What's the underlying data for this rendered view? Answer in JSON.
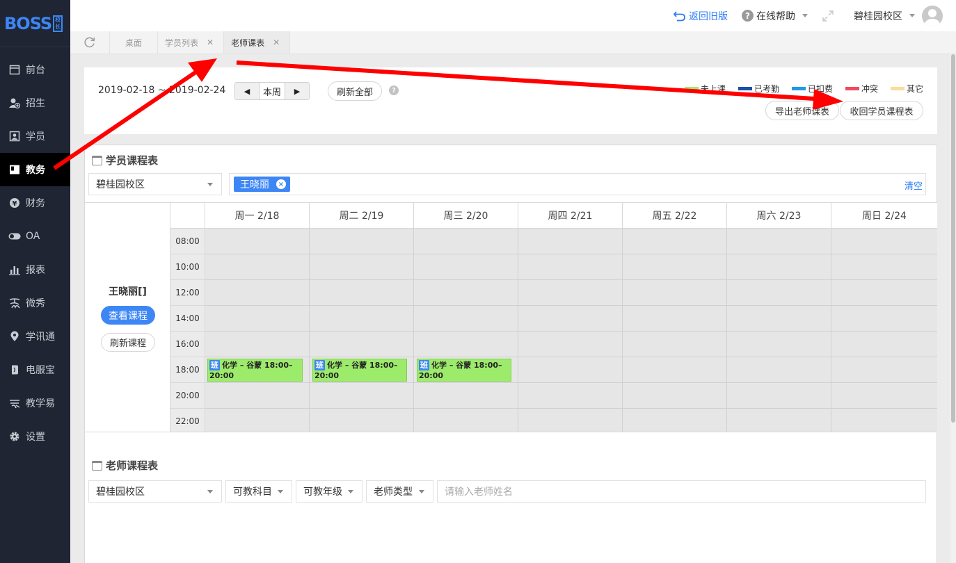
{
  "logo": {
    "text": "BOSS",
    "badge_top": "校",
    "badge_bottom": "长"
  },
  "sidebar": {
    "items": [
      {
        "label": "前台",
        "icon": "calendar-icon"
      },
      {
        "label": "招生",
        "icon": "user-add-icon"
      },
      {
        "label": "学员",
        "icon": "id-card-icon"
      },
      {
        "label": "教务",
        "icon": "book-icon",
        "active": true
      },
      {
        "label": "财务",
        "icon": "yen-icon"
      },
      {
        "label": "OA",
        "icon": "toggle-icon"
      },
      {
        "label": "报表",
        "icon": "bar-chart-icon"
      },
      {
        "label": "微秀",
        "icon": "xiu-icon"
      },
      {
        "label": "学讯通",
        "icon": "location-pin-icon"
      },
      {
        "label": "电服宝",
        "icon": "phone-icon"
      },
      {
        "label": "教学易",
        "icon": "teach-icon"
      },
      {
        "label": "设置",
        "icon": "gear-icon"
      }
    ]
  },
  "header": {
    "back_label": "返回旧版",
    "help_label": "在线帮助",
    "campus_label": "碧桂园校区"
  },
  "tabs": [
    {
      "label": "桌面",
      "closable": false
    },
    {
      "label": "学员列表",
      "closable": true
    },
    {
      "label": "老师课表",
      "closable": true,
      "active": true
    }
  ],
  "toolbar": {
    "date_range": "2019-02-18 ~ 2019-02-24",
    "prev": "◀",
    "this_week": "本周",
    "next": "▶",
    "refresh_all": "刷新全部",
    "help": "?",
    "export_teacher": "导出老师课表",
    "collapse_student": "收回学员课程表",
    "legend": [
      {
        "label": "未上课",
        "color": "#9deb6b"
      },
      {
        "label": "已考勤",
        "color": "#1b4fa8"
      },
      {
        "label": "已扣费",
        "color": "#1e9be8"
      },
      {
        "label": "冲突",
        "color": "#f04a5d"
      },
      {
        "label": "其它",
        "color": "#fbdc9c"
      }
    ]
  },
  "student_schedule": {
    "title": "学员课程表",
    "campus": "碧桂园校区",
    "tag": "王晓丽",
    "tag_remove": "×",
    "clear": "清空",
    "student_name": "王晓丽[]",
    "view_course": "查看课程",
    "refresh_course": "刷新课程",
    "days": [
      "周一 2/18",
      "周二 2/19",
      "周三 2/20",
      "周四 2/21",
      "周五 2/22",
      "周六 2/23",
      "周日 2/24"
    ],
    "times": [
      "08:00",
      "10:00",
      "12:00",
      "14:00",
      "16:00",
      "18:00",
      "20:00",
      "22:00"
    ],
    "events": [
      {
        "badge": "班",
        "text": "化学 – 谷蒙 18:00–20:00"
      },
      {
        "badge": "班",
        "text": "化学 – 谷蒙 18:00–20:00"
      },
      {
        "badge": "班",
        "text": "化学 – 谷蒙 18:00–20:00"
      }
    ]
  },
  "teacher_schedule": {
    "title": "老师课程表",
    "campus": "碧桂园校区",
    "subject": "可教科目",
    "grade": "可教年级",
    "teacher_type": "老师类型",
    "name_placeholder": "请输入老师姓名"
  }
}
